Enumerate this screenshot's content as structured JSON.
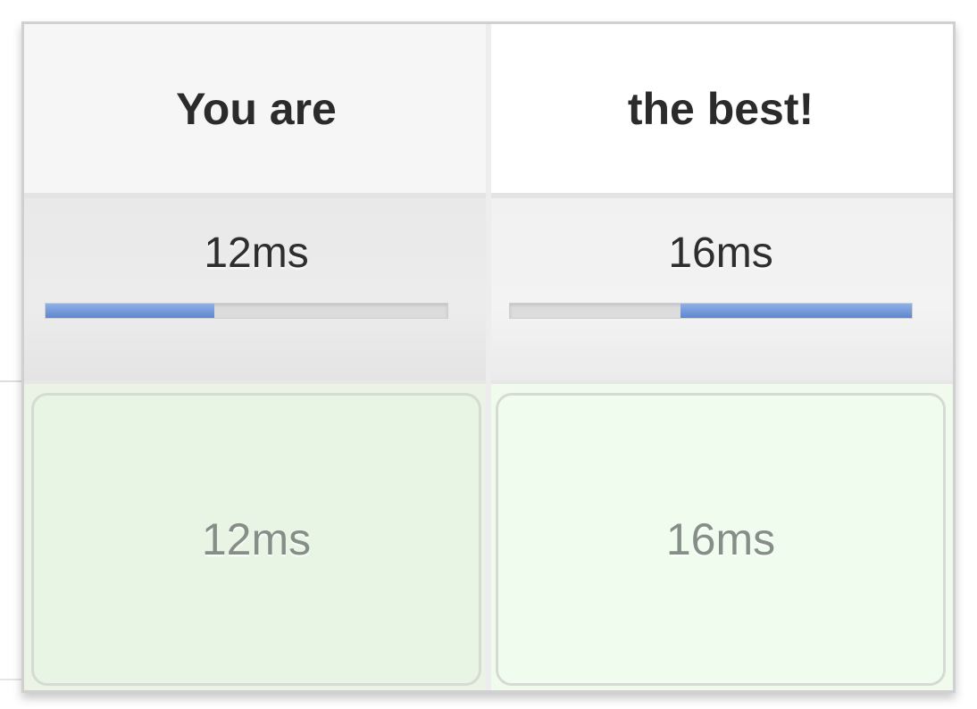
{
  "columns": [
    {
      "heading": "You are",
      "metric_value": "12ms",
      "bar_fraction": 0.42,
      "bar_direction": "from-left",
      "result_value": "12ms"
    },
    {
      "heading": "the best!",
      "metric_value": "16ms",
      "bar_fraction": 0.575,
      "bar_direction": "from-right",
      "result_value": "16ms"
    }
  ],
  "colors": {
    "bar_fill": "#6b8fd3",
    "result_bg": "#eaf5e6"
  }
}
